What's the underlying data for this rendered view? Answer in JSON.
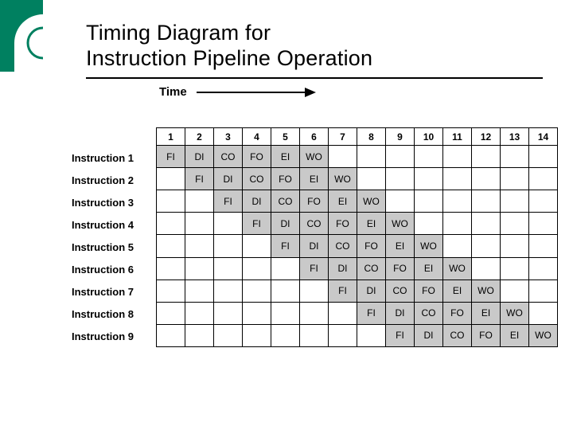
{
  "title_line1": "Timing Diagram for",
  "title_line2": "Instruction Pipeline Operation",
  "time_label": "Time",
  "stages": [
    "FI",
    "DI",
    "CO",
    "FO",
    "EI",
    "WO"
  ],
  "cycles": [
    "1",
    "2",
    "3",
    "4",
    "5",
    "6",
    "7",
    "8",
    "9",
    "10",
    "11",
    "12",
    "13",
    "14"
  ],
  "instructions": [
    {
      "label": "Instruction 1",
      "start": 1
    },
    {
      "label": "Instruction 2",
      "start": 2
    },
    {
      "label": "Instruction 3",
      "start": 3
    },
    {
      "label": "Instruction 4",
      "start": 4
    },
    {
      "label": "Instruction 5",
      "start": 5
    },
    {
      "label": "Instruction 6",
      "start": 6
    },
    {
      "label": "Instruction 7",
      "start": 7
    },
    {
      "label": "Instruction 8",
      "start": 8
    },
    {
      "label": "Instruction 9",
      "start": 9
    }
  ]
}
